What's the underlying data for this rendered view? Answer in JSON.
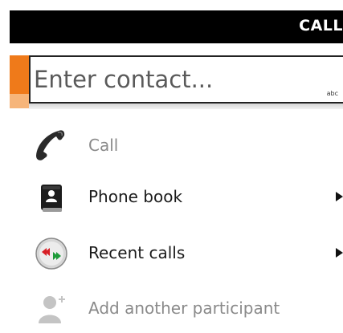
{
  "header": {
    "title": "CALL"
  },
  "contact_input": {
    "placeholder": "Enter contact...",
    "value": "",
    "input_mode": "abc"
  },
  "menu": [
    {
      "label": "Call",
      "icon": "phone-handset-icon",
      "enabled": false
    },
    {
      "label": "Phone book",
      "icon": "phone-book-icon",
      "enabled": true,
      "submenu": true
    },
    {
      "label": "Recent calls",
      "icon": "recent-calls-icon",
      "enabled": true,
      "submenu": true
    },
    {
      "label": "Add another participant",
      "icon": "add-participant-icon",
      "enabled": false
    }
  ],
  "colors": {
    "accent": "#ef7a1a",
    "title_bar": "#000000",
    "disabled_text": "#8a8a8a"
  }
}
